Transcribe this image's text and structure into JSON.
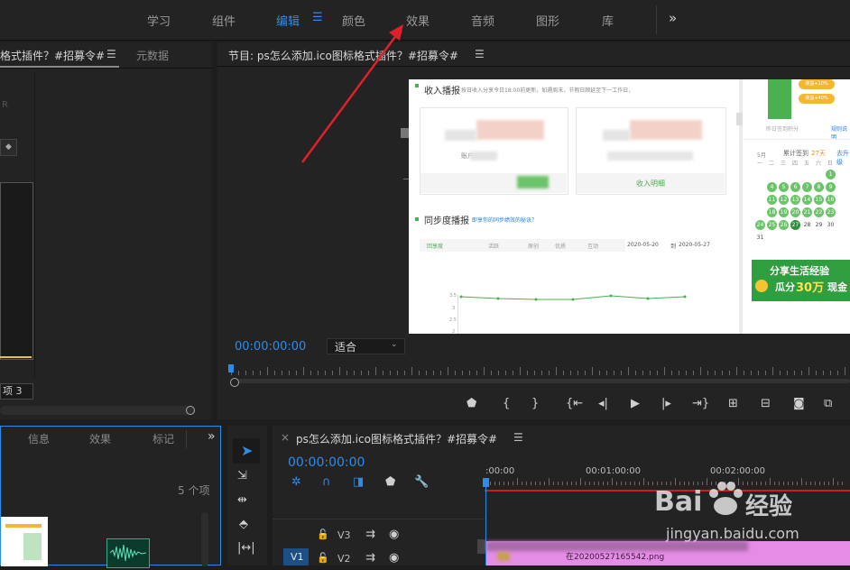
{
  "topnav": {
    "tabs": [
      {
        "label": "学习"
      },
      {
        "label": "组件"
      },
      {
        "label": "编辑"
      },
      {
        "label": "颜色"
      },
      {
        "label": "效果"
      },
      {
        "label": "音频"
      },
      {
        "label": "图形"
      },
      {
        "label": "库"
      }
    ],
    "more_icon": "»"
  },
  "source_panel": {
    "tab_title": "格式插件？#招募令#",
    "menu_icon": "☰",
    "metadata_tab": "元数据",
    "letter": "R",
    "field_value": "项 3"
  },
  "program_monitor": {
    "title": "节目: ps怎么添加.ico图标格式插件？#招募令#",
    "menu_icon": "☰",
    "timecode": "00:00:00:00",
    "fit_select": "适合",
    "controls": [
      "marker-icon",
      "mark-in-icon",
      "mark-out-icon",
      "go-to-in-icon",
      "step-back-icon",
      "play-icon",
      "step-forward-icon",
      "go-to-out-icon",
      "insert-icon",
      "overwrite-icon",
      "camera-icon",
      "export-frame-icon"
    ]
  },
  "preview": {
    "section1_title": "收入播报",
    "section1_desc": "按日收入分享今日18:00前更新，如遇周末，节假日顺延至下一工作日，",
    "income_link": "收入明细",
    "account_label": "账户",
    "section2_title": "同步度播报",
    "section2_link": "即享你的同步绩效的秘诀？",
    "chart_tabs": [
      "回享度",
      "活跃",
      "原创",
      "优质",
      "互动"
    ],
    "date_from": "2020-05-20",
    "date_sep": "到",
    "date_to": "2020-05-27",
    "y_ticks": [
      "3.5",
      "3",
      "2.5",
      "2"
    ],
    "side_badges": [
      "收益+10%",
      "收益+40%"
    ],
    "side_link": "规则说明",
    "side_caption": "昨日签到积分",
    "streak_label": "累计签到",
    "streak_days": "27天",
    "streak_more": "去升级",
    "month_label": "5月",
    "weekdays": [
      "一",
      "二",
      "三",
      "四",
      "五",
      "六",
      "日"
    ],
    "cal_rows": [
      [
        "",
        "",
        "",
        "",
        "",
        "",
        "1"
      ],
      [
        "",
        "4",
        "5",
        "6",
        "7",
        "8",
        "9"
      ],
      [
        "",
        "11",
        "12",
        "13",
        "14",
        "15",
        "16"
      ],
      [
        "",
        "18",
        "19",
        "20",
        "21",
        "22",
        "23"
      ],
      [
        "24",
        "25",
        "26",
        "27",
        "28",
        "29",
        "30"
      ],
      [
        "31",
        "",
        "",
        "",
        "",
        "",
        ""
      ]
    ],
    "banner_line1": "分享生活经验",
    "banner_line2_a": "瓜分",
    "banner_line2_b": "30万",
    "banner_line2_c": "现金"
  },
  "project_panel": {
    "tabs": [
      "信息",
      "效果",
      "标记"
    ],
    "more_icon": "»",
    "item_count": "5 个项"
  },
  "tools": [
    "selection-tool-icon",
    "track-select-icon",
    "ripple-edit-icon",
    "razor-icon",
    "slip-icon"
  ],
  "timeline": {
    "close_icon": "×",
    "title": "ps怎么添加.ico图标格式插件？#招募令#",
    "menu_icon": "☰",
    "timecode": "00:00:00:00",
    "ruler_labels": [
      ":00:00",
      "00:01:00:00",
      "00:02:00:00"
    ],
    "tracks": [
      {
        "name": "V3"
      },
      {
        "name": "V2"
      }
    ],
    "source_track": "V1",
    "clip_name": "在20200527165542.png"
  },
  "watermark": {
    "brand": "Bai",
    "brand2": "经验",
    "url": "jingyan.baidu.com"
  },
  "annotation": {
    "arrow_color": "#e0202a"
  }
}
